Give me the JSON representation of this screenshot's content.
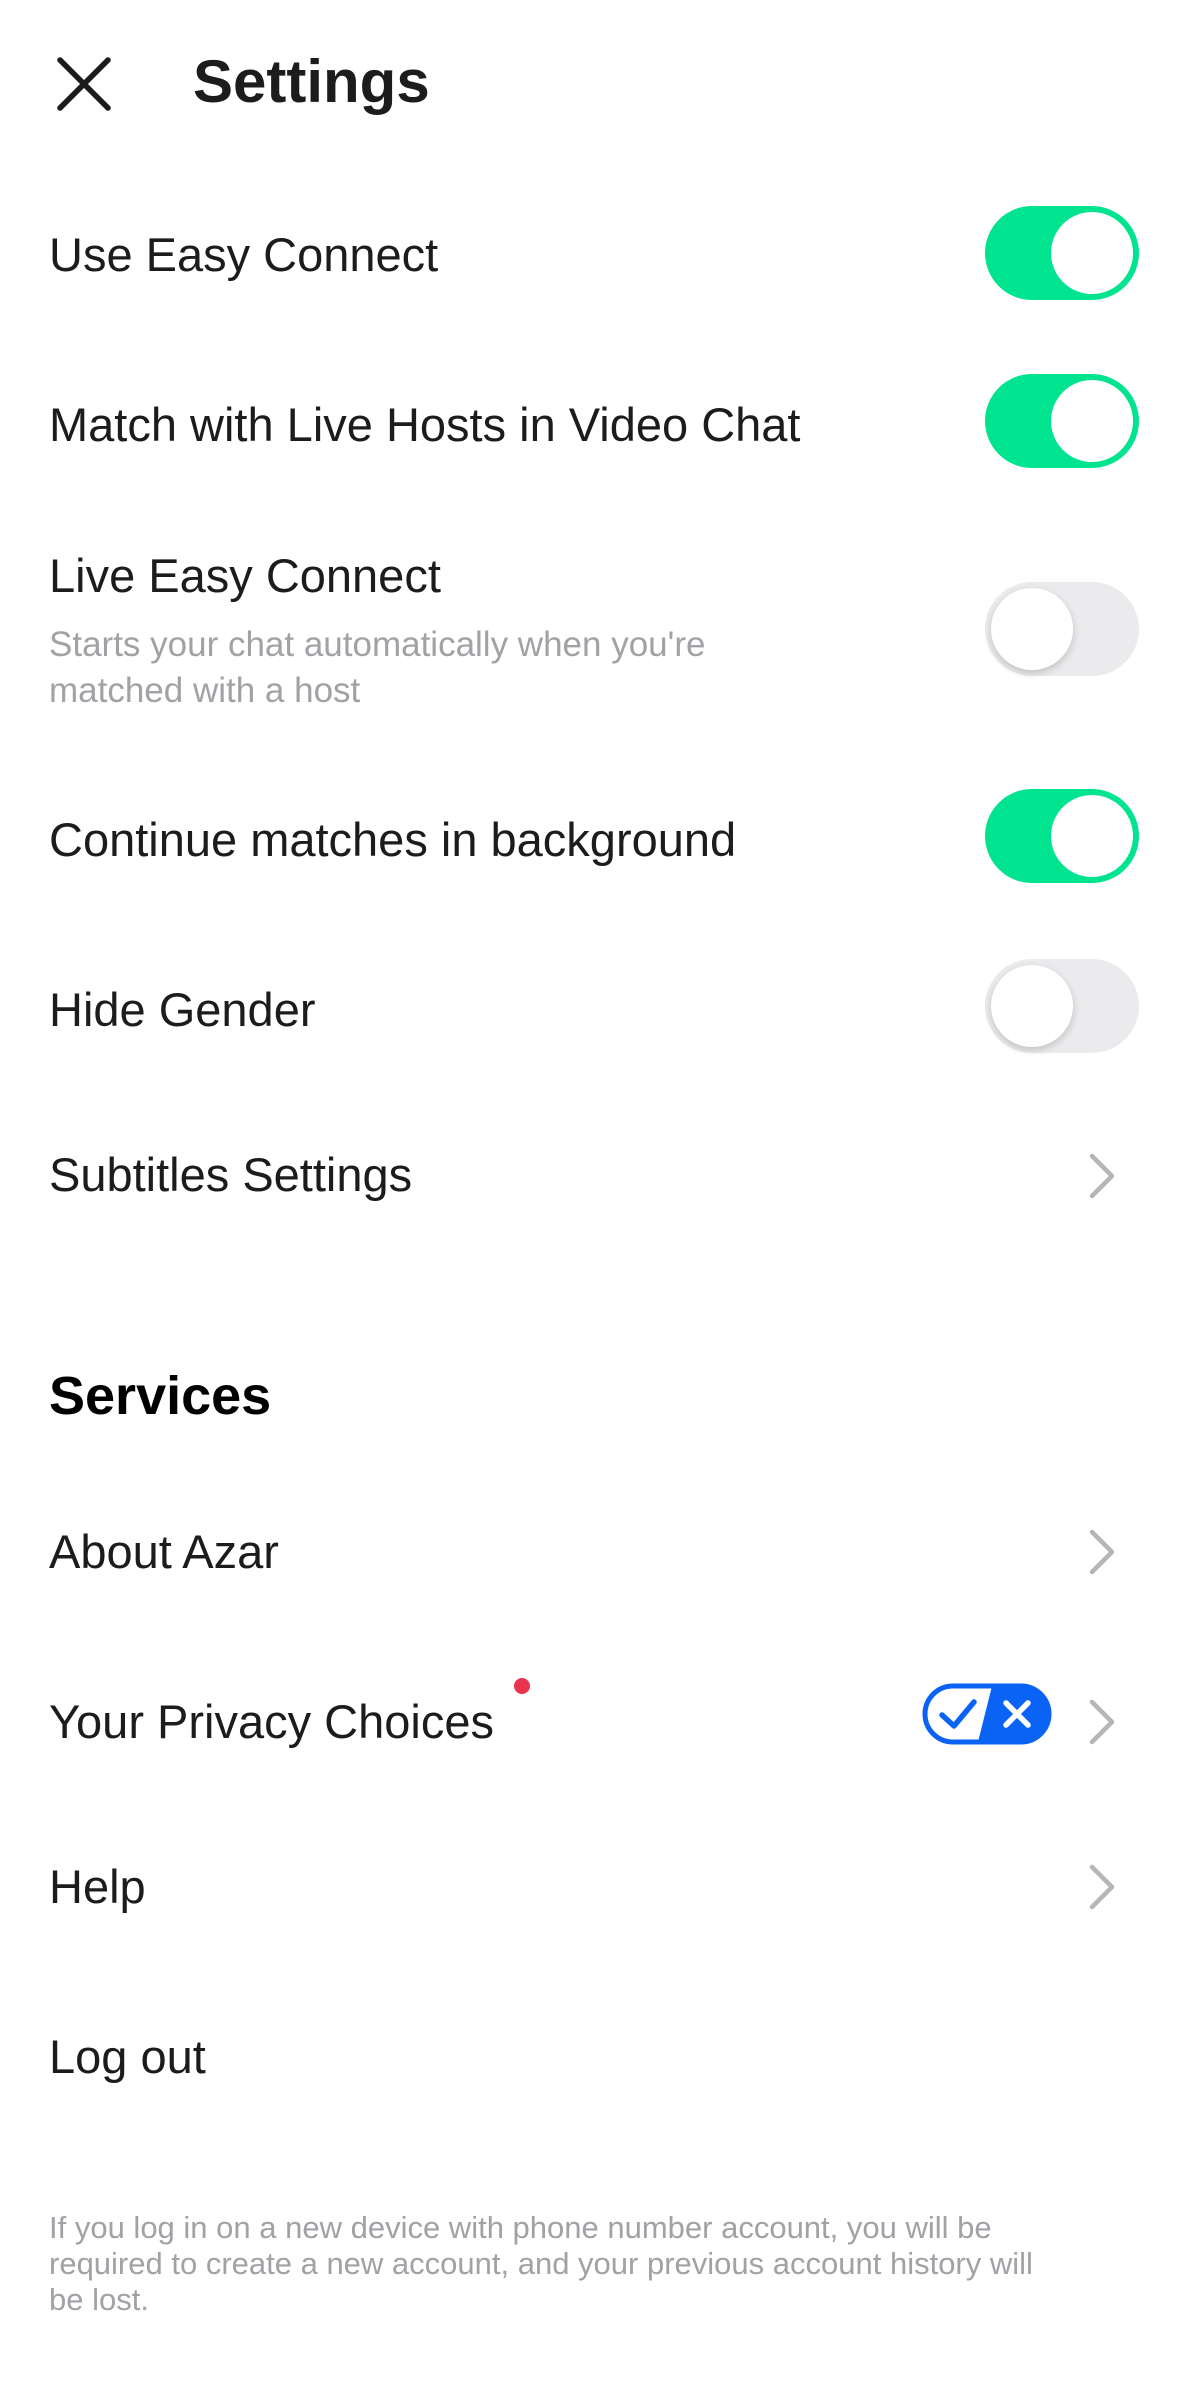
{
  "header": {
    "title": "Settings",
    "close_icon": "close-icon"
  },
  "settings": {
    "use_easy_connect": {
      "label": "Use Easy Connect",
      "enabled": true
    },
    "match_live_hosts": {
      "label": "Match with Live Hosts in Video Chat",
      "enabled": true
    },
    "live_easy_connect": {
      "label": "Live Easy Connect",
      "description_line1": "Starts your chat automatically when you're",
      "description_line2": "matched with a host",
      "enabled": false
    },
    "continue_matches": {
      "label": "Continue matches in background",
      "enabled": true
    },
    "hide_gender": {
      "label": "Hide Gender",
      "enabled": false
    },
    "subtitles": {
      "label": "Subtitles Settings",
      "icon": "chevron-right-icon"
    }
  },
  "services": {
    "title": "Services",
    "about": {
      "label": "About Azar",
      "icon": "chevron-right-icon"
    },
    "privacy": {
      "label": "Your Privacy Choices",
      "badge_icon": "privacy-choices-icon",
      "has_notification_dot": true
    },
    "help": {
      "label": "Help",
      "icon": "chevron-right-icon"
    },
    "logout": {
      "label": "Log out"
    }
  },
  "footnote": {
    "line1": "If you log in on a new device with phone number account, you will be",
    "line2": "required to create a new account, and your previous account history will",
    "line3": "be lost."
  },
  "colors": {
    "toggle_on": "#00e38f",
    "toggle_off": "#ebebed",
    "privacy_blue": "#0b63f5",
    "notification_dot": "#e8344c",
    "secondary_text": "#a1a1a6"
  }
}
